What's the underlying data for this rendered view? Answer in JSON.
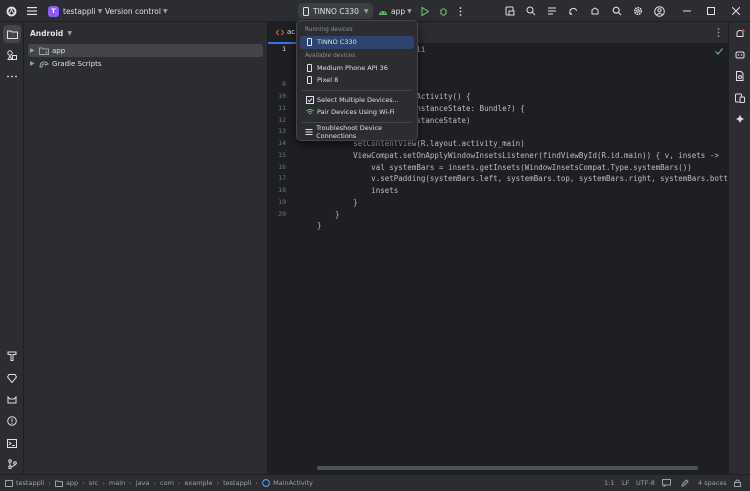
{
  "colors": {
    "accent": "#3574f0",
    "project_badge": "#8b5cf6",
    "run": "#5fb865",
    "debug": "#5fb865",
    "selection": "#2e436e",
    "notification": "#e5493a"
  },
  "titlebar": {
    "project_badge": "T",
    "project_name": "testappli",
    "vcs_label": "Version control",
    "device_label": "TINNO C330",
    "run_config": "app"
  },
  "project_panel": {
    "title": "Android",
    "items": [
      {
        "label": "app",
        "icon": "folder-icon"
      },
      {
        "label": "Gradle Scripts",
        "icon": "gradle-icon"
      }
    ]
  },
  "editor": {
    "tab_label": "ac",
    "line_numbers": [
      "1",
      "",
      "",
      "8",
      "10",
      "11",
      "12",
      "13",
      "14",
      "15",
      "16",
      "17",
      "18",
      "19",
      "20"
    ],
    "code_lines": [
      "                  tappli",
      "",
      "",
      "",
      "               pCompatActivity() {",
      "              e(savedInstanceState: Bundle?) {",
      "               savedInstanceState)",
      "                 e()",
      "        setContentView(R.layout.activity_main)",
      "        ViewCompat.setOnApplyWindowInsetsListener(findViewById(R.id.main)) { v, insets ->",
      "            val systemBars = insets.getInsets(WindowInsetsCompat.Type.systemBars())",
      "            v.setPadding(systemBars.left, systemBars.top, systemBars.right, systemBars.bottom)",
      "            insets",
      "        }",
      "    }",
      "}"
    ]
  },
  "dropdown": {
    "running_header": "Running devices",
    "running": [
      {
        "label": "TINNO C330",
        "icon": "phone-icon"
      }
    ],
    "available_header": "Available devices",
    "available": [
      {
        "label": "Medium Phone API 36",
        "icon": "phone-icon"
      },
      {
        "label": "Pixel 8",
        "icon": "phone-icon"
      }
    ],
    "actions": [
      {
        "label": "Select Multiple Devices...",
        "icon": "multi-device-icon"
      },
      {
        "label": "Pair Devices Using Wi-Fi",
        "icon": "wifi-icon"
      },
      {
        "label": "Troubleshoot Device Connections",
        "icon": "list-icon"
      }
    ]
  },
  "statusbar": {
    "breadcrumbs": [
      "testappli",
      "app",
      "src",
      "main",
      "java",
      "com",
      "example",
      "testappli",
      "MainActivity"
    ],
    "position": "1:1",
    "line_sep": "LF",
    "encoding": "UTF-8",
    "indent": "4 spaces"
  }
}
